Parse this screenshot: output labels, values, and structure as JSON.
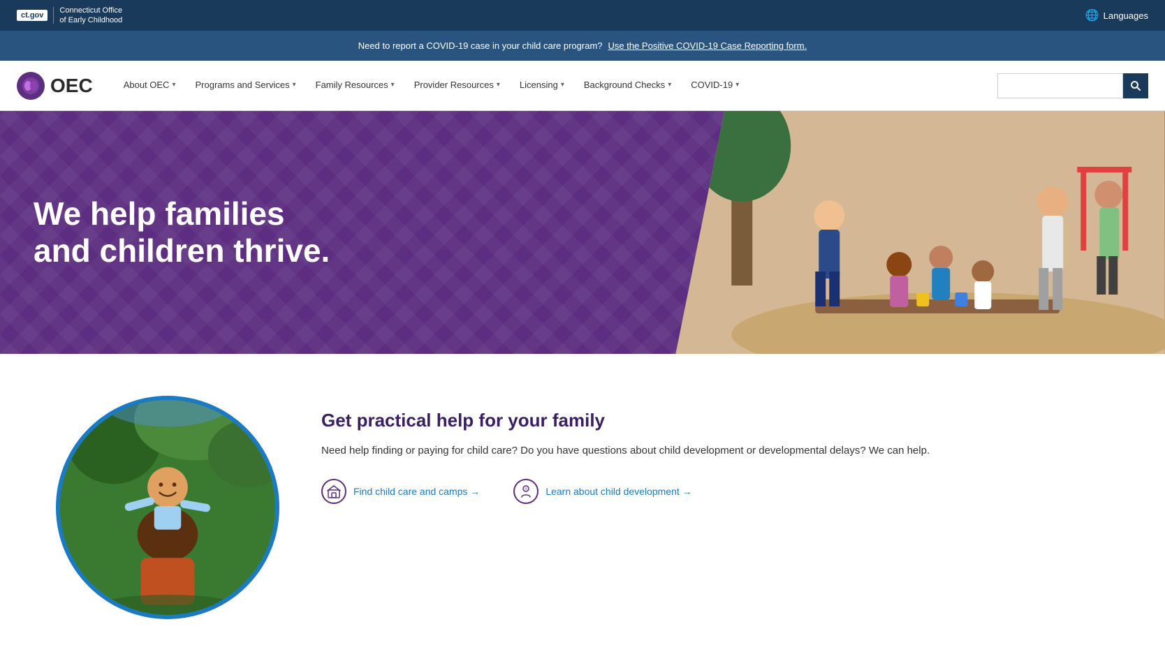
{
  "govBar": {
    "ctGovLabel": "ct.gov",
    "agencyName": "Connecticut Office\nof Early Childhood",
    "languagesLabel": "Languages"
  },
  "alertBanner": {
    "message": "Need to report a COVID-19 case in your child care program?",
    "linkText": "Use the Positive COVID-19 Case Reporting form."
  },
  "nav": {
    "logoText": "OEC",
    "items": [
      {
        "label": "About OEC",
        "hasDropdown": true
      },
      {
        "label": "Programs and Services",
        "hasDropdown": true
      },
      {
        "label": "Family Resources",
        "hasDropdown": true
      },
      {
        "label": "Provider Resources",
        "hasDropdown": true
      },
      {
        "label": "Licensing",
        "hasDropdown": true
      },
      {
        "label": "Background Checks",
        "hasDropdown": true
      },
      {
        "label": "COVID-19",
        "hasDropdown": true
      }
    ],
    "searchPlaceholder": ""
  },
  "hero": {
    "headline": "We help families\nand children thrive."
  },
  "contentSection": {
    "title": "Get practical help for your family",
    "description": "Need help finding or paying for child care? Do you have questions about child development or developmental delays? We can help.",
    "links": [
      {
        "icon": "🏠",
        "label": "Find child care and camps →"
      },
      {
        "icon": "👶",
        "label": "Learn about child development →"
      }
    ]
  }
}
